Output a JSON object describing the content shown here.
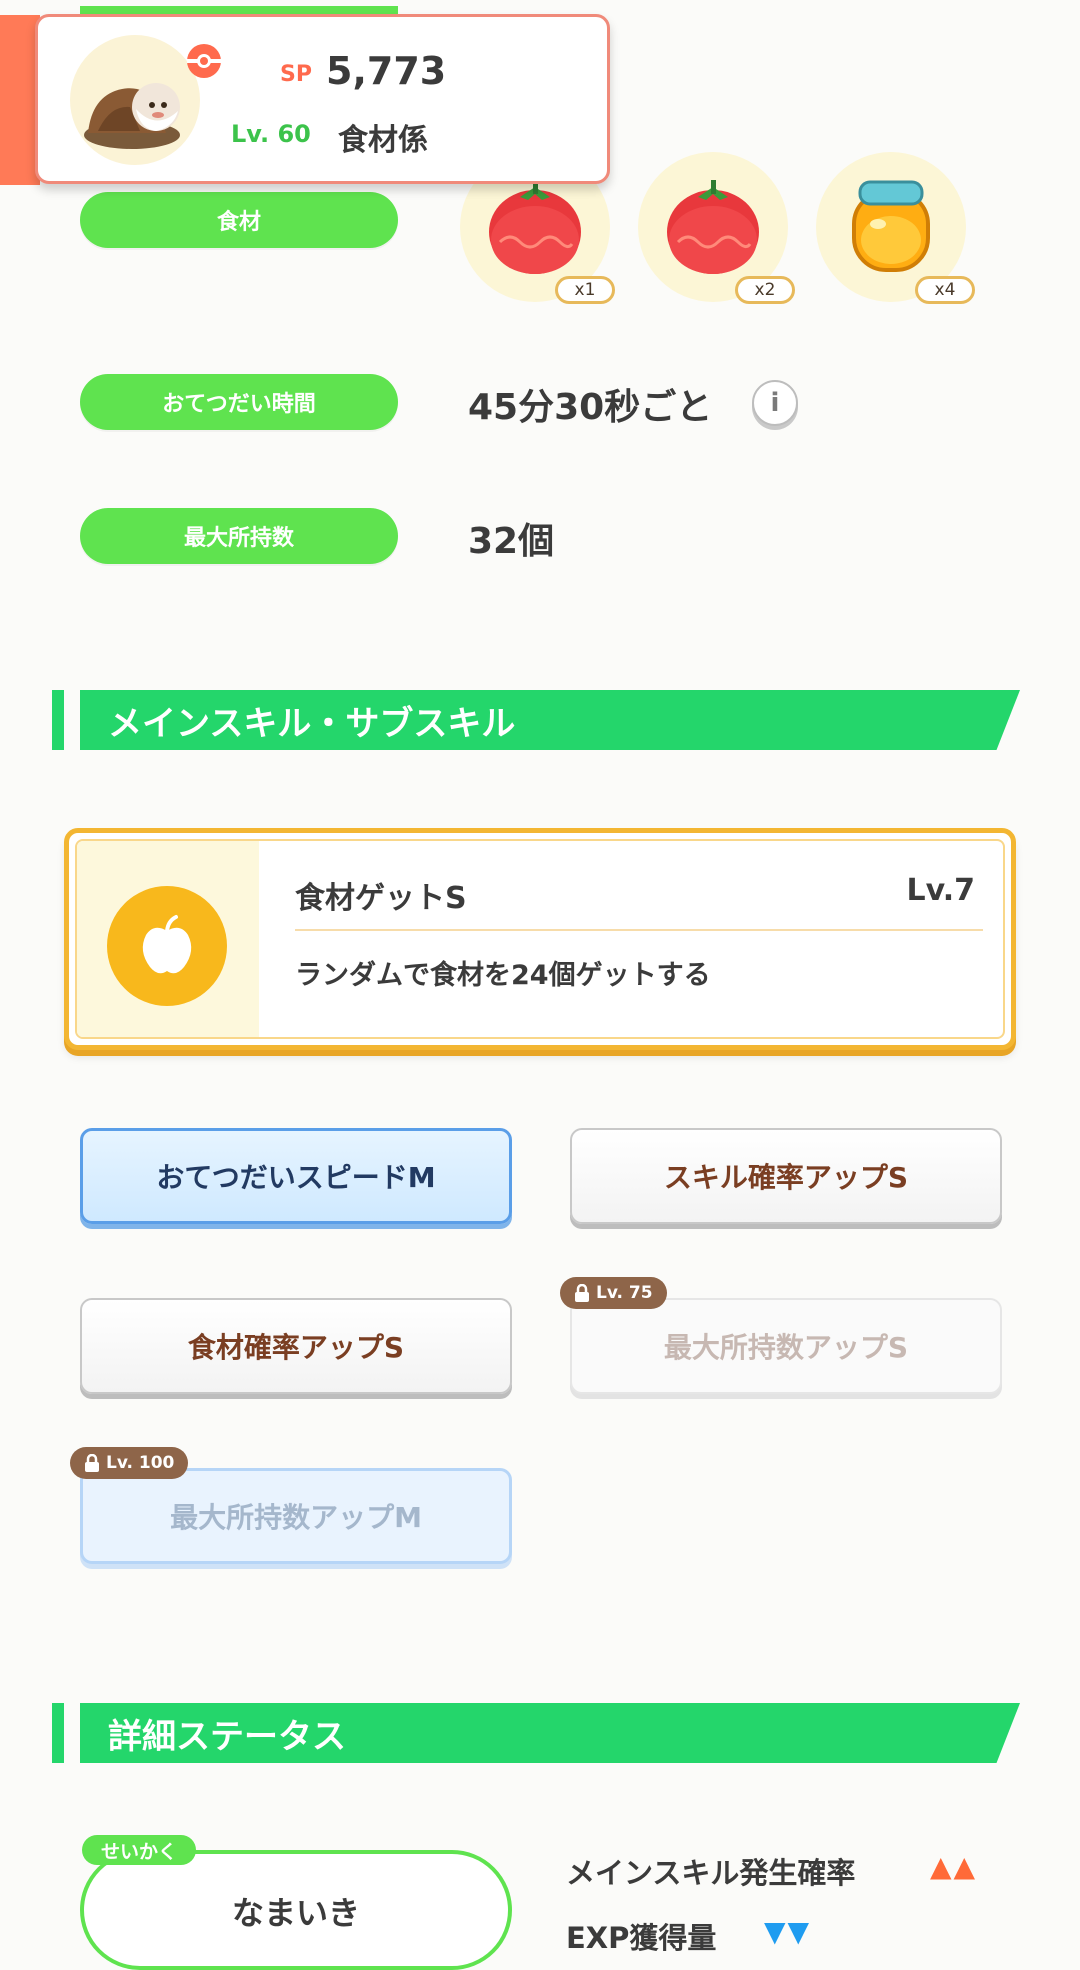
{
  "header": {
    "sp_label": "SP",
    "sp_value": "5,773",
    "level": "Lv. 60",
    "role": "食材係"
  },
  "rows": {
    "ingredients_label": "食材",
    "ingredients": [
      {
        "name": "tomato",
        "count": "x1"
      },
      {
        "name": "tomato",
        "count": "x2"
      },
      {
        "name": "honey",
        "count": "x4"
      }
    ],
    "help_time_label": "おてつだい時間",
    "help_time_value": "45分30秒ごと",
    "info_icon": "i",
    "max_carry_label": "最大所持数",
    "max_carry_value": "32個"
  },
  "skills_section": {
    "title": "メインスキル・サブスキル",
    "main_skill": {
      "name": "食材ゲットS",
      "level": "Lv.7",
      "description": "ランダムで食材を24個ゲットする",
      "icon": "apple-icon"
    },
    "sub_skills": [
      {
        "label": "おてつだいスピードM"
      },
      {
        "label": "スキル確率アップS"
      },
      {
        "label": "食材確率アップS"
      },
      {
        "label": "最大所持数アップS",
        "lock": "Lv. 75"
      },
      {
        "label": "最大所持数アップM",
        "lock": "Lv. 100"
      }
    ]
  },
  "details_section": {
    "title": "詳細ステータス",
    "nature_tag": "せいかく",
    "nature": "なまいき",
    "effects": [
      {
        "label": "メインスキル発生確率",
        "arrows": "▲▲"
      },
      {
        "label": "EXP獲得量",
        "arrows": "▼▼"
      }
    ]
  },
  "colors": {
    "accent_green": "#24d66b",
    "pill_green": "#5fe34f",
    "sp_orange": "#ff6a4d",
    "gold_border": "#f3b632",
    "up_arrow": "#ff6a38",
    "down_arrow": "#1f9cf0"
  }
}
